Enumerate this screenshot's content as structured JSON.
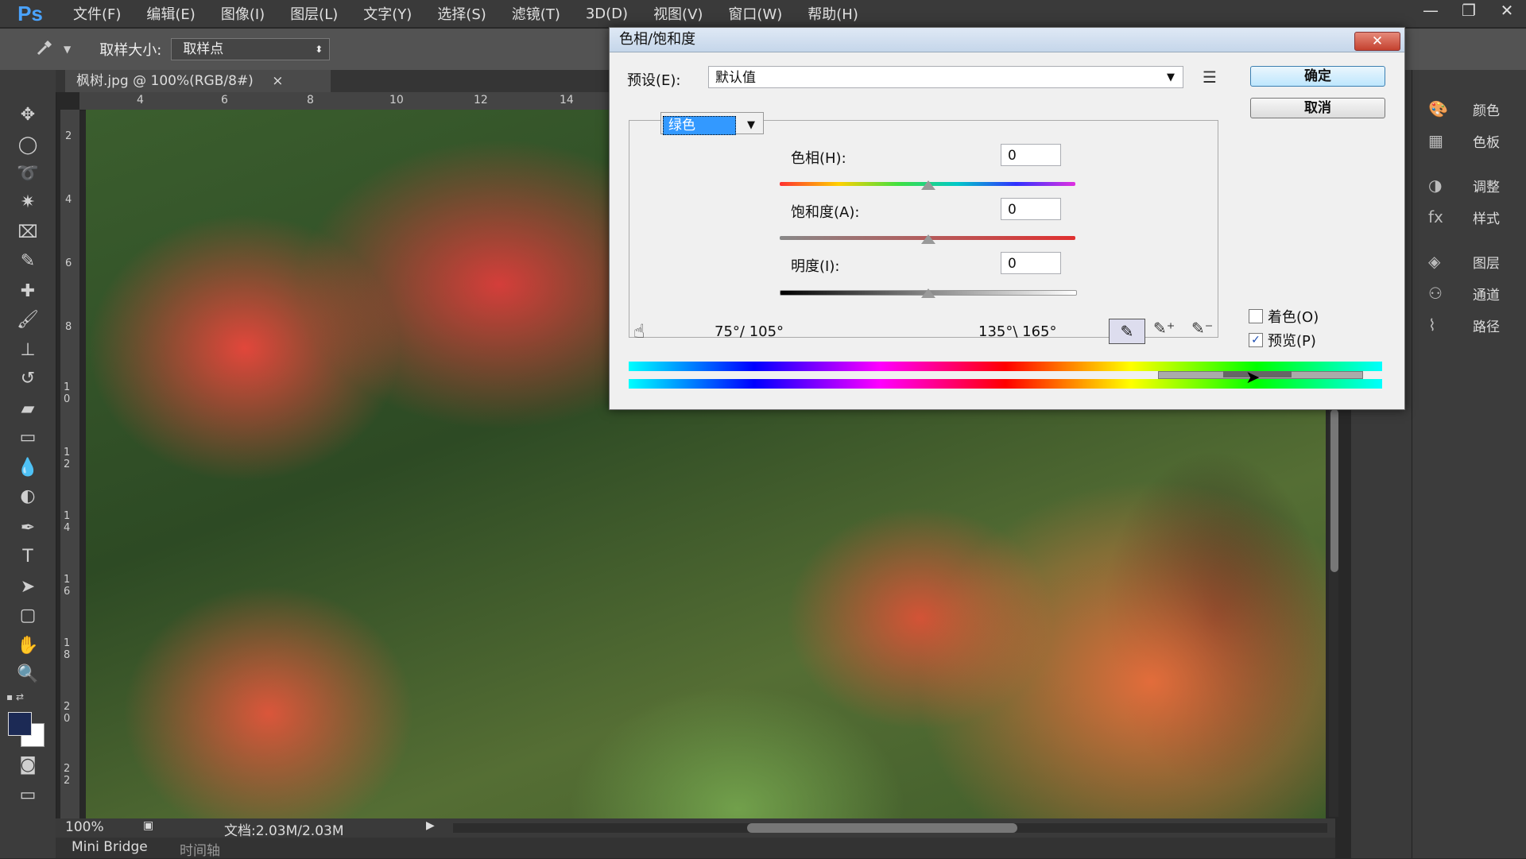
{
  "app": {
    "logo": "Ps",
    "menu": [
      "文件(F)",
      "编辑(E)",
      "图像(I)",
      "图层(L)",
      "文字(Y)",
      "选择(S)",
      "滤镜(T)",
      "3D(D)",
      "视图(V)",
      "窗口(W)",
      "帮助(H)"
    ],
    "window_controls": [
      "—",
      "❐",
      "✕"
    ]
  },
  "options_bar": {
    "sample_size_label": "取样大小:",
    "sample_size_value": "取样点"
  },
  "document": {
    "tab_title": "枫树.jpg @ 100%(RGB/8#)",
    "tab_close": "×",
    "hruler_ticks": [
      "4",
      "6",
      "8",
      "10",
      "12",
      "14"
    ],
    "vruler_ticks": [
      "2",
      "4",
      "6",
      "8",
      "1 0",
      "1 2",
      "1 4",
      "1 6",
      "1 8",
      "2 0",
      "2 2"
    ],
    "zoom": "100%",
    "doc_info": "文档:2.03M/2.03M"
  },
  "bottom_tabs": [
    "Mini Bridge",
    "时间轴"
  ],
  "right_panel": {
    "items": [
      "颜色",
      "色板",
      "调整",
      "样式",
      "图层",
      "通道",
      "路径"
    ]
  },
  "dialog": {
    "title": "色相/饱和度",
    "preset_label": "预设(E):",
    "preset_value": "默认值",
    "ok": "确定",
    "cancel": "取消",
    "channel": "绿色",
    "hue_label": "色相(H):",
    "hue_value": "0",
    "saturation_label": "饱和度(A):",
    "saturation_value": "0",
    "lightness_label": "明度(I):",
    "lightness_value": "0",
    "range_left": "75°/ 105°",
    "range_right": "135°\\ 165°",
    "colorize_label": "着色(O)",
    "colorize_checked": false,
    "preview_label": "预览(P)",
    "preview_checked": true
  }
}
